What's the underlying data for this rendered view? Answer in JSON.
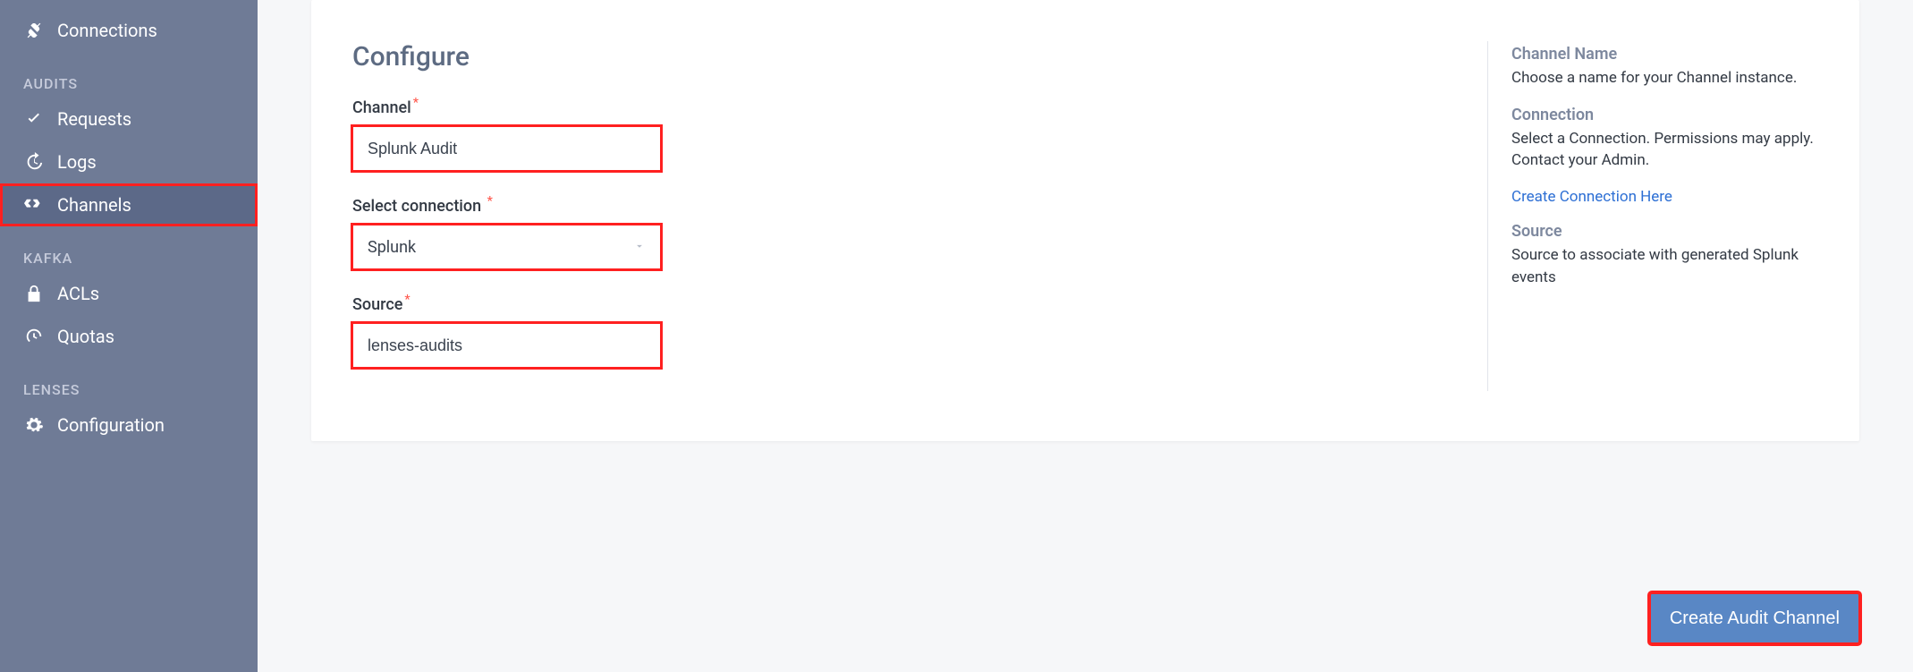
{
  "sidebar": {
    "top": {
      "label": "Connections"
    },
    "section_audits": "AUDITS",
    "audits": [
      {
        "label": "Requests"
      },
      {
        "label": "Logs"
      },
      {
        "label": "Channels"
      }
    ],
    "section_kafka": "KAFKA",
    "kafka": [
      {
        "label": "ACLs"
      },
      {
        "label": "Quotas"
      }
    ],
    "section_lenses": "LENSES",
    "lenses": [
      {
        "label": "Configuration"
      }
    ]
  },
  "form": {
    "title": "Configure",
    "channel_label": "Channel",
    "channel_value": "Splunk Audit",
    "connection_label": "Select connection",
    "connection_value": "Splunk",
    "source_label": "Source",
    "source_value": "lenses-audits",
    "required_marker": "*"
  },
  "help": {
    "name_title": "Channel Name",
    "name_text": "Choose a name for your Channel instance.",
    "conn_title": "Connection",
    "conn_text": "Select a Connection. Permissions may apply. Contact your Admin.",
    "conn_link": "Create Connection Here",
    "source_title": "Source",
    "source_text": "Source to associate with generated Splunk events"
  },
  "actions": {
    "create": "Create Audit Channel"
  }
}
